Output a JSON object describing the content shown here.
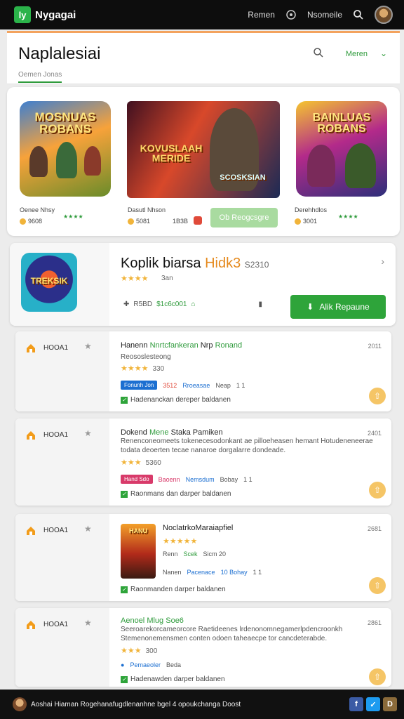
{
  "topbar": {
    "brand": "Nygagai",
    "logo_letter": "ly",
    "link1": "Remen",
    "link2": "Nsomeile"
  },
  "header": {
    "title": "Naplalesiai",
    "menu_label": "Meren",
    "tab_label": "Oemen Jonas"
  },
  "featured": [
    {
      "art_text": "MOSNUAS ROBANS",
      "name": "Oenee Nhsy",
      "price": "9608",
      "rating_text": "★★★★"
    },
    {
      "art_text": "KOVUSLAAH MERIDE",
      "art_sub": "SCOSKSIAN",
      "name": "Dasutl Nhson",
      "price": "5081",
      "extra": "1B3B"
    },
    {
      "art_text": "BAINLUAS ROBANS",
      "name": "Derehhdlos",
      "price": "3001",
      "rating_text": "★★★★"
    }
  ],
  "featured_button": "Ob Reogcsgre",
  "highlight": {
    "art_text": "TREKSIK",
    "title": "Koplik biarsa",
    "title_accent": "Hidk3",
    "title_small": "S2310",
    "stars": "★★★★",
    "meta": "3an",
    "price1": "R5BD",
    "price2": "$1c6c001",
    "button": "Alik Repaune"
  },
  "list": [
    {
      "category": "HOOA1",
      "title_a": "Hanenn",
      "title_b": "Nnrtcfankeran",
      "title_c": "Nrp",
      "title_d": "Ronand",
      "time": "2011",
      "desc": "Reososlesteong",
      "stars": "★★★★",
      "stars_meta": "330",
      "tags": [
        "Fonunh Jon",
        "3512",
        "Rroeasae",
        "Neap",
        "1 1"
      ],
      "check": "Hadenanckan dereper baldanen"
    },
    {
      "category": "HOOA1",
      "title_a": "Dokend",
      "title_b": "Mene",
      "title_c": "Staka Pamiken",
      "time": "2401",
      "desc": "Renenconeomeets tokenecesodonkant ae pilloeheasen hemant Hotudeneneerae todata deoerten tecae nanaroe dorgalarre dondeade.",
      "stars": "★★★",
      "stars_meta": "5360",
      "tags": [
        "Hand Sdo",
        "Baoenn",
        "Nemsdum",
        "Bobay",
        "1 1"
      ],
      "check": "Raonmans dan darper baldanen"
    },
    {
      "category": "HOOA1",
      "title_a": "Noclatrko",
      "title_b": "Maraiapfiel",
      "time": "2681",
      "thumb_text": "HANU",
      "stars": "★★★★★",
      "extra_a": "Renn",
      "extra_b": "Scek",
      "extra_c": "Sicm 20",
      "tags": [
        "Nanen",
        "Pacenace",
        "10 Bohay",
        "1 1"
      ],
      "check": "Raonmanden darper baldanen"
    },
    {
      "category": "HOOA1",
      "title_a": "Aenoel",
      "title_b": "Mlug",
      "title_c": "Soe6",
      "time": "2861",
      "desc": "Seeroarekorcameorcore Raetideenes lrdenonomnegamerlpdencroonkh Stemenonemensmen conten odoen taheaecpe tor cancdeterabde.",
      "stars": "★★★",
      "stars_meta": "300",
      "tags": [
        "Pemaeoler",
        "Beda"
      ],
      "check": "Hadenawden darper baldanen"
    }
  ],
  "bottombar": {
    "text": "Aoshai Hiaman Rogehanafugdlenanhne bgel 4 opoukchanga Doost"
  }
}
